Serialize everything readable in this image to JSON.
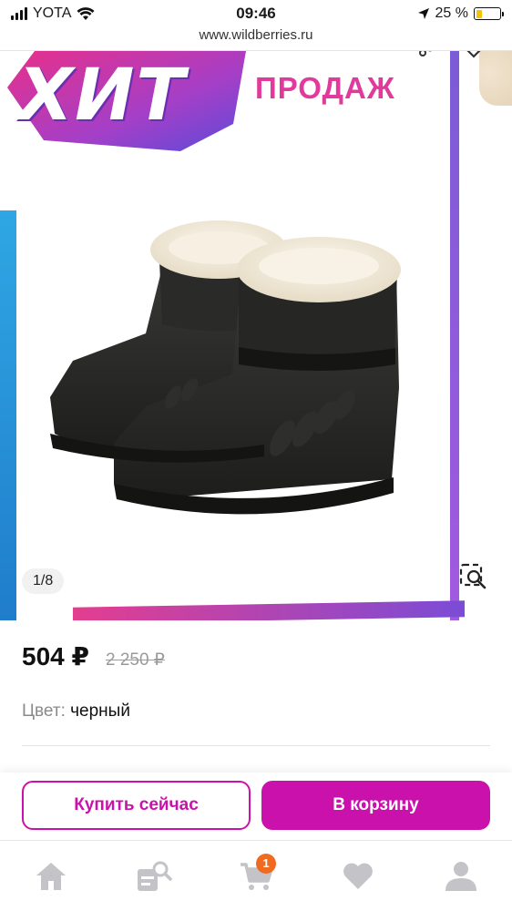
{
  "status_bar": {
    "carrier": "YOTA",
    "time": "09:46",
    "battery": "25 %"
  },
  "browser": {
    "url": "www.wildberries.ru"
  },
  "product": {
    "banner_hit": "ХИТ",
    "banner_sales": "ПРОДАЖ",
    "image_counter": "1/8",
    "price_current": "504 ₽",
    "price_old": "2 250 ₽",
    "color_label": "Цвет:",
    "color_value": "черный"
  },
  "actions": {
    "buy_now": "Купить сейчас",
    "add_to_cart": "В корзину"
  },
  "bottom_nav": {
    "cart_count": "1",
    "items": [
      "home-icon",
      "catalog-search-icon",
      "cart-icon",
      "heart-icon",
      "profile-icon"
    ]
  },
  "colors": {
    "accent": "#cb11ab",
    "badge": "#f06a20",
    "banner_pink": "#e03a9c"
  }
}
